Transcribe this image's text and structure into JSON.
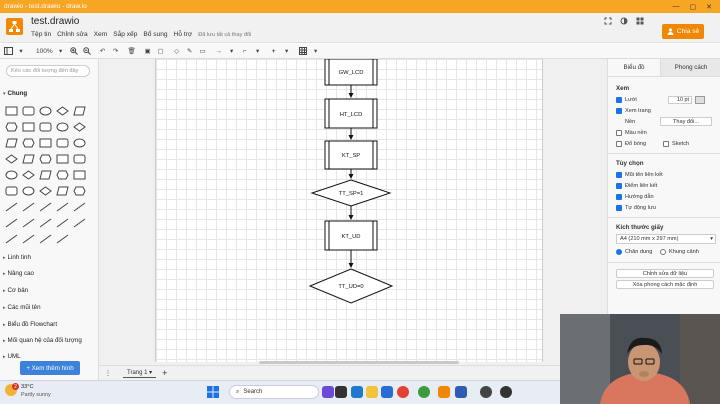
{
  "browser": {
    "title": "drawio - test.drawio - draw.io",
    "min": "—",
    "max": "▢",
    "close": "✕"
  },
  "app": {
    "title": "test.drawio",
    "menus": [
      "Tệp tin",
      "Chỉnh sửa",
      "Xem",
      "Sắp xếp",
      "Bổ sung",
      "Hỗ trợ"
    ],
    "save_status": "Đã lưu tất cả thay đổi",
    "share": "Chia sẻ"
  },
  "toolbar": {
    "zoom": "100%"
  },
  "left": {
    "search_placeholder": "Kéo các đối tượng đến đây",
    "sections": [
      "Chung",
      "Linh tinh",
      "Nâng cao",
      "Cơ bản",
      "Các mũi tên",
      "Biểu đồ Flowchart",
      "Mối quan hệ của đối tượng",
      "UML"
    ],
    "more_shapes": "+ Xem thêm hình"
  },
  "diagram": {
    "nodes": [
      "GW_LCD",
      "HT_LCD",
      "KT_SP",
      "TT_SP=1",
      "KT_UD",
      "TT_UD=0"
    ]
  },
  "pages": {
    "current": "Trang 1"
  },
  "right": {
    "tabs": [
      "Biểu đồ",
      "Phong cách"
    ],
    "view_heading": "Xem",
    "grid": "Lưới",
    "grid_size": "10 pt",
    "page_view": "Xem trang",
    "background": "Nền",
    "change": "Thay đổi...",
    "bg_color": "Màu nền",
    "shadow": "Đổ bóng",
    "sketch": "Sketch",
    "options_heading": "Tùy chọn",
    "options": [
      "Mũi tên liên kết",
      "Điểm liên kết",
      "Hướng dẫn",
      "Tự động lưu"
    ],
    "paper_heading": "Kích thước giấy",
    "paper": "A4 (210 mm x 297 mm)",
    "portrait": "Chân dung",
    "landscape": "Khung cảnh",
    "edit_data": "Chỉnh sửa dữ liệu",
    "clear_style": "Xóa phong cách mặc định"
  },
  "taskbar": {
    "temp": "33°C",
    "weather": "Partly sunny",
    "search": "Search",
    "badge": "2"
  }
}
